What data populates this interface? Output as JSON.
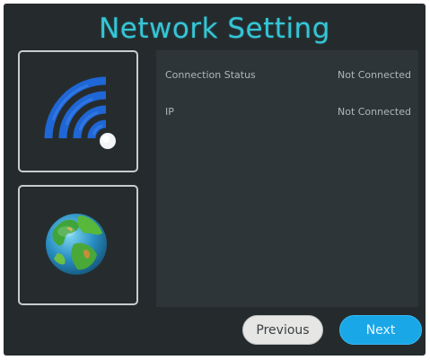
{
  "header": {
    "title": "Network Setting"
  },
  "sidebar": {
    "items": [
      {
        "icon": "wifi-icon"
      },
      {
        "icon": "globe-icon"
      }
    ]
  },
  "info": {
    "rows": [
      {
        "label": "Connection Status",
        "value": "Not Connected"
      },
      {
        "label": "IP",
        "value": "Not Connected"
      }
    ]
  },
  "footer": {
    "previous_label": "Previous",
    "next_label": "Next"
  },
  "colors": {
    "title": "#35c6d6",
    "background": "#252b2d",
    "panel": "#2d3538",
    "next_button": "#19a7e8",
    "previous_button": "#e6e6e4"
  }
}
